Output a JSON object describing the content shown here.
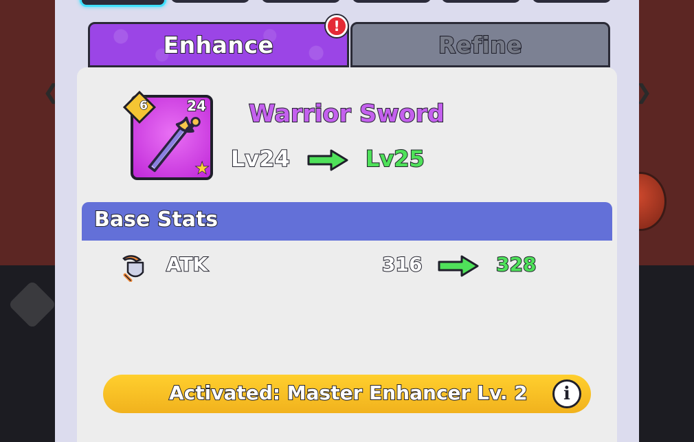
{
  "tabs": {
    "enhance_label": "Enhance",
    "refine_label": "Refine",
    "alert_glyph": "!"
  },
  "item": {
    "name": "Warrior Sword",
    "rank": "6",
    "level": "24",
    "level_from": "Lv24",
    "level_to": "Lv25",
    "icon": "sword-icon",
    "rarity_icon": "star-icon"
  },
  "stats": {
    "title": "Base Stats",
    "rows": [
      {
        "name": "ATK",
        "from": "316",
        "to": "328",
        "icon": "attack-icon"
      }
    ]
  },
  "activated": {
    "text": "Activated: Master Enhancer Lv. 2",
    "info_glyph": "i"
  },
  "colors": {
    "enhance_tab": "#9b45e6",
    "refine_tab": "#7c8193",
    "item_bg": "#c94ee0",
    "stats_header": "#6370d8",
    "upgrade_green": "#4fe15a",
    "activated_bar": "#f6bd22",
    "alert_red": "#e42b36"
  }
}
